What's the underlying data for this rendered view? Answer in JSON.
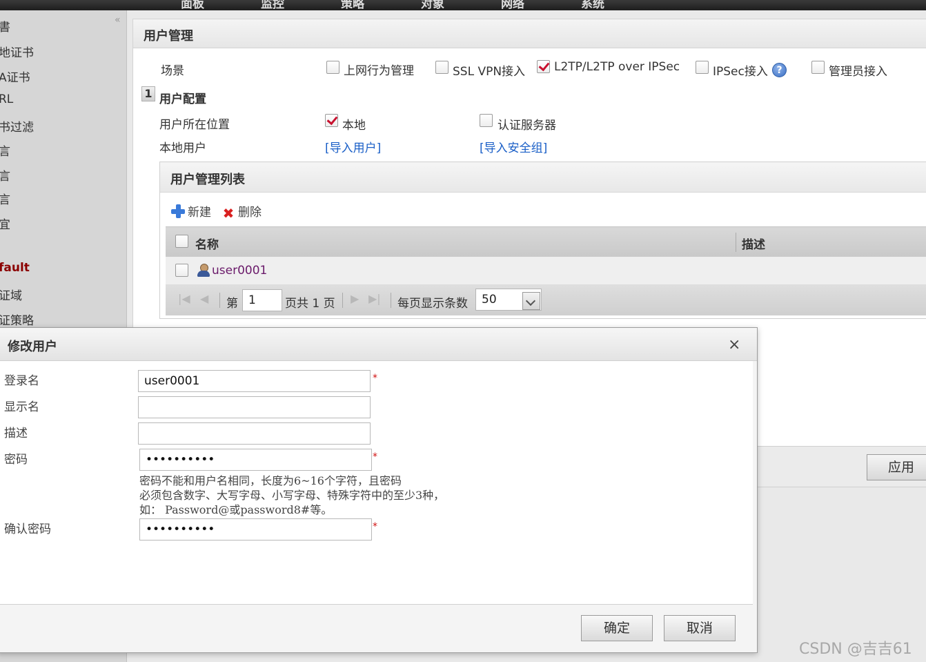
{
  "topnav": {
    "items": [
      "面板",
      "监控",
      "策略",
      "对象",
      "网络",
      "系统"
    ]
  },
  "sidebar": {
    "collapse_glyph": "«",
    "items": [
      {
        "label": "書"
      },
      {
        "label": "地证书"
      },
      {
        "label": "A证书"
      },
      {
        "label": "RL"
      },
      {
        "label": "书过滤"
      },
      {
        "label": "言"
      },
      {
        "label": "言"
      },
      {
        "label": "言"
      },
      {
        "label": "宜"
      },
      {
        "label": "fault"
      },
      {
        "label": "证域"
      },
      {
        "label": "证策略"
      }
    ]
  },
  "page": {
    "title": "用户管理"
  },
  "scene": {
    "label": "场景",
    "options": [
      {
        "label": "上网行为管理",
        "checked": false
      },
      {
        "label": "SSL VPN接入",
        "checked": false
      },
      {
        "label": "L2TP/L2TP over IPSec",
        "checked": true
      },
      {
        "label": "IPSec接入",
        "checked": false
      },
      {
        "label": "管理员接入",
        "checked": false
      }
    ],
    "help_glyph": "?"
  },
  "user_config": {
    "step": "1",
    "title": "用户配置",
    "location_label": "用户所在位置",
    "location_options": [
      {
        "label": "本地",
        "checked": true
      },
      {
        "label": "认证服务器",
        "checked": false
      }
    ],
    "local_user_label": "本地用户",
    "import_users": "[导入用户]",
    "import_groups": "[导入安全组]"
  },
  "user_list": {
    "title": "用户管理列表",
    "new_label": "新建",
    "delete_label": "删除",
    "delete_glyph": "✖",
    "columns": [
      "名称",
      "描述"
    ],
    "rows": [
      {
        "name": "user0001",
        "desc": ""
      }
    ],
    "pager": {
      "first": "|◀",
      "prev": "◀",
      "next": "▶",
      "last": "▶|",
      "page_prefix": "第",
      "page_value": "1",
      "page_suffix": "页共 1 页",
      "per_page_label": "每页显示条数",
      "per_page_value": "50"
    }
  },
  "apply": {
    "label": "应用"
  },
  "dialog": {
    "title": "修改用户",
    "close_glyph": "×",
    "fields": {
      "login_label": "登录名",
      "login_value": "user0001",
      "display_label": "显示名",
      "display_value": "",
      "desc_label": "描述",
      "desc_value": "",
      "password_label": "密码",
      "password_value": "••••••••••",
      "confirm_label": "确认密码",
      "confirm_value": "••••••••••"
    },
    "required_mark": "*",
    "hint": [
      "密码不能和用户名相同，长度为6~16个字符，且密码",
      "必须包含数字、大写字母、小写字母、特殊字符中的至少3种，",
      "如： Password@或password8#等。"
    ],
    "ok_label": "确定",
    "cancel_label": "取消"
  },
  "watermark": "CSDN @吉吉61"
}
